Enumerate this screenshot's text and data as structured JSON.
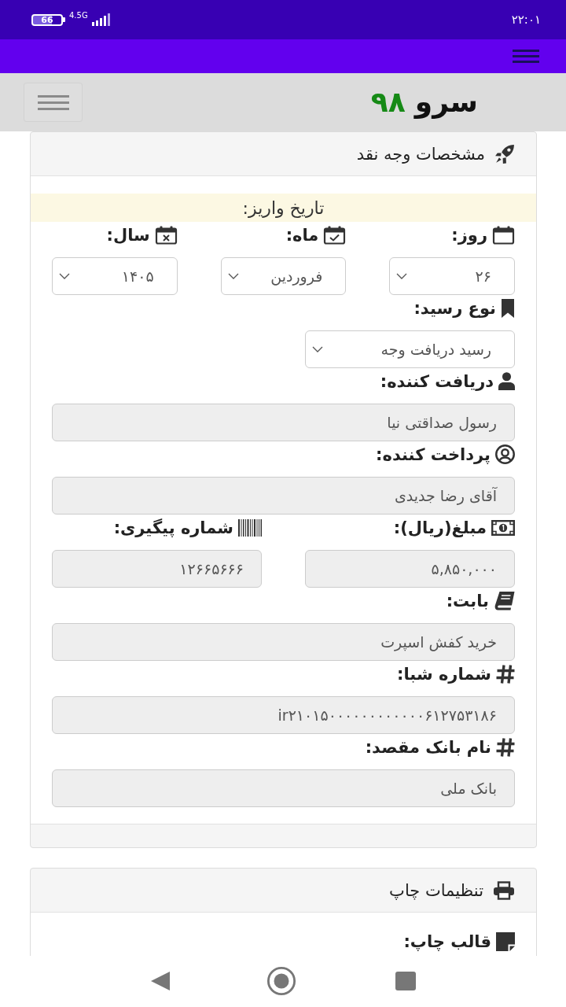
{
  "status_bar": {
    "battery": "66",
    "network": "4.5G",
    "time": "۲۲:۰۱"
  },
  "header": {
    "logo_text": "سرو",
    "logo_number": "۹۸"
  },
  "cards": [
    {
      "title": "مشخصات وجه نقد",
      "notice": "تاریخ واریز:",
      "field_groups": [
        {
          "fields": [
            {
              "kind": "select",
              "label": "روز:",
              "value": "۲۶",
              "readonly": false
            },
            {
              "kind": "select",
              "label": "ماه:",
              "value": "فروردین",
              "readonly": false
            },
            {
              "kind": "select",
              "label": "سال:",
              "value": "۱۴۰۵",
              "readonly": false
            }
          ]
        },
        {
          "fields": [
            {
              "kind": "select",
              "label": "نوع رسید:",
              "value": "رسید دریافت وجه",
              "readonly": false
            }
          ]
        },
        {
          "fields": [
            {
              "kind": "text",
              "label": "دریافت کننده:",
              "value": "رسول صداقتی نیا",
              "readonly": true
            }
          ]
        },
        {
          "fields": [
            {
              "kind": "text",
              "label": "پرداخت کننده:",
              "value": "آقای رضا جدیدی",
              "readonly": true
            }
          ]
        },
        {
          "fields": [
            {
              "kind": "text",
              "label": "مبلغ(ریال):",
              "value": "۵,۸۵۰,۰۰۰",
              "readonly": true
            },
            {
              "kind": "text",
              "label": "شماره پیگیری:",
              "value": "۱۲۶۶۵۶۶۶",
              "readonly": true
            }
          ]
        },
        {
          "fields": [
            {
              "kind": "text",
              "label": "بابت:",
              "value": "خرید کفش اسپرت",
              "readonly": true
            }
          ]
        },
        {
          "fields": [
            {
              "kind": "text",
              "label": "شماره شبا:",
              "value": "ir۲۱۰۱۵۰۰۰۰۰۰۰۰۰۰۰۰۶۱۲۷۵۳۱۸۶",
              "readonly": true
            }
          ]
        },
        {
          "fields": [
            {
              "kind": "text",
              "label": "نام بانک مقصد:",
              "value": "بانک ملی",
              "readonly": true
            }
          ]
        }
      ]
    },
    {
      "title": "تنظیمات چاپ",
      "field_groups": [
        {
          "fields": [
            {
              "kind": "label",
              "label": "قالب چاپ:"
            }
          ]
        }
      ]
    }
  ]
}
